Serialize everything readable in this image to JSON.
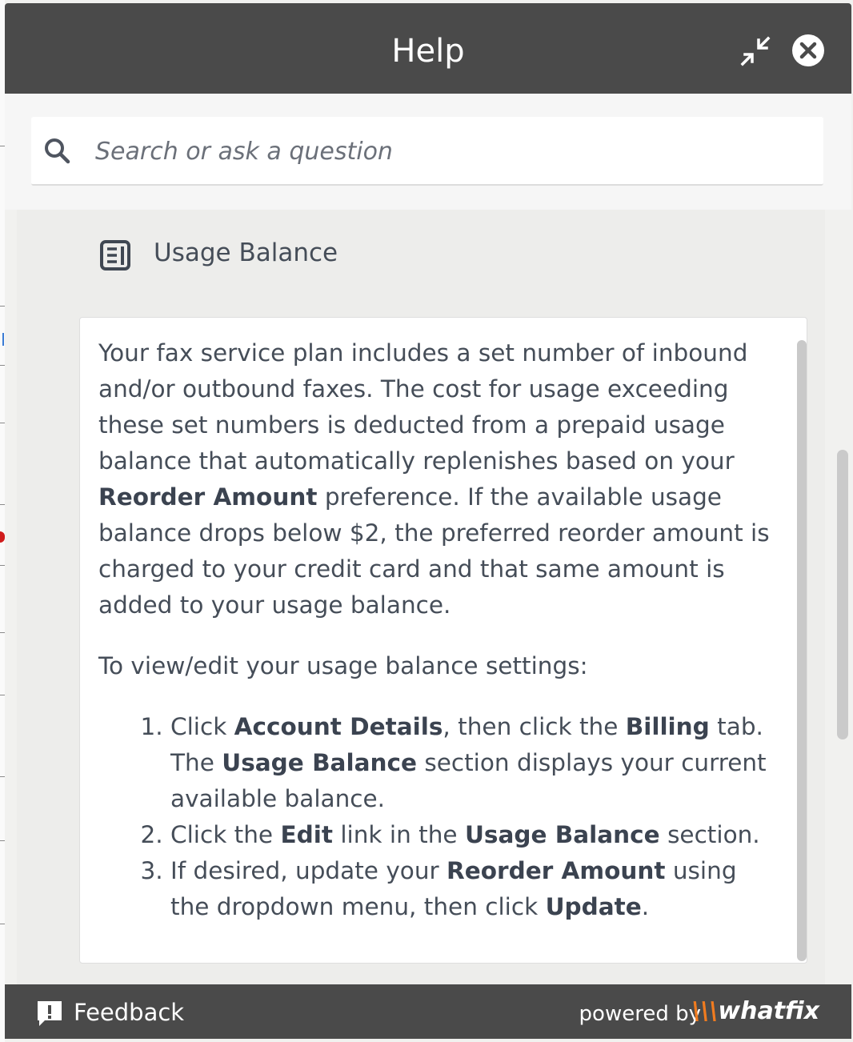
{
  "panel": {
    "title": "Help"
  },
  "search": {
    "placeholder": "Search or ask a question"
  },
  "article": {
    "title": "Usage Balance",
    "intro": [
      {
        "t": "Your fax service plan includes a set number of inbound and/or outbound faxes. The cost for usage exceeding these set numbers is deducted from a prepaid usage balance that automatically replenishes based on your "
      },
      {
        "b": "Reorder Amount"
      },
      {
        "t": " preference. If the available usage balance drops below $2, the preferred reorder amount is charged to your credit card and that same amount is added to your usage balance."
      }
    ],
    "lead": "To view/edit your usage balance settings:",
    "steps": [
      [
        {
          "t": "Click "
        },
        {
          "b": "Account Details"
        },
        {
          "t": ", then click the "
        },
        {
          "b": "Billing"
        },
        {
          "t": " tab. The "
        },
        {
          "b": "Usage Balance"
        },
        {
          "t": " section displays your current available balance."
        }
      ],
      [
        {
          "t": "Click the "
        },
        {
          "b": "Edit"
        },
        {
          "t": " link in the "
        },
        {
          "b": "Usage Balance"
        },
        {
          "t": " section."
        }
      ],
      [
        {
          "t": "If desired, update your "
        },
        {
          "b": "Reorder Amount"
        },
        {
          "t": " using the dropdown menu, then click "
        },
        {
          "b": "Update"
        },
        {
          "t": "."
        }
      ]
    ]
  },
  "footer": {
    "feedback_label": "Feedback",
    "powered_label": "powered by",
    "brand_mark": "\\\\\\",
    "brand_name": "whatfix"
  },
  "icons": {
    "minimize": "minimize-icon",
    "close": "close-icon",
    "search": "search-icon",
    "article": "article-icon",
    "feedback": "feedback-icon"
  },
  "colors": {
    "header_bg": "#4a4a4a",
    "brand_accent": "#f07b1f",
    "text": "#454d58"
  }
}
